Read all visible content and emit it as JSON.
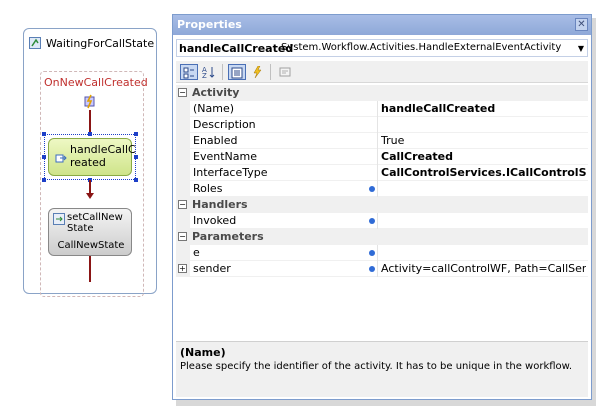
{
  "workflow": {
    "state_title": "WaitingForCallState",
    "event_title": "OnNewCallCreated",
    "activity1_label": "handleCallC\nreated",
    "activity2_label": "setCallNew\nState",
    "activity2_target": "CallNewState",
    "colors": {
      "line": "#8a1515",
      "event_title": "#c0302e",
      "selection": "#1d3fc8"
    }
  },
  "properties": {
    "title": "Properties",
    "close_icon": "close-icon",
    "object_name": "handleCallCreated",
    "object_type": "System.Workflow.Activities.HandleExternalEventActivity",
    "toolbar": [
      "categorized-icon",
      "alphabetical-icon",
      "properties-icon",
      "events-icon",
      "property-pages-icon"
    ],
    "categories": [
      {
        "label": "Activity",
        "rows": [
          {
            "name": "(Name)",
            "value": "handleCallCreated",
            "bold": true
          },
          {
            "name": "Description",
            "value": ""
          },
          {
            "name": "Enabled",
            "value": "True"
          },
          {
            "name": "EventName",
            "value": "CallCreated",
            "bold": true
          },
          {
            "name": "InterfaceType",
            "value": "CallControlServices.ICallControlService",
            "bold": true
          },
          {
            "name": "Roles",
            "value": "",
            "bind_dot": true
          }
        ]
      },
      {
        "label": "Handlers",
        "rows": [
          {
            "name": "Invoked",
            "value": "",
            "bind_dot": true
          }
        ]
      },
      {
        "label": "Parameters",
        "rows": [
          {
            "name": "e",
            "value": "",
            "bind_dot": true
          },
          {
            "name": "sender",
            "value": "Activity=callControlWF, Path=CallSender",
            "bind_dot": true,
            "expandable": true
          }
        ]
      }
    ],
    "description": {
      "title": "(Name)",
      "text": "Please specify the identifier of the activity. It has to be unique in the workflow."
    }
  }
}
